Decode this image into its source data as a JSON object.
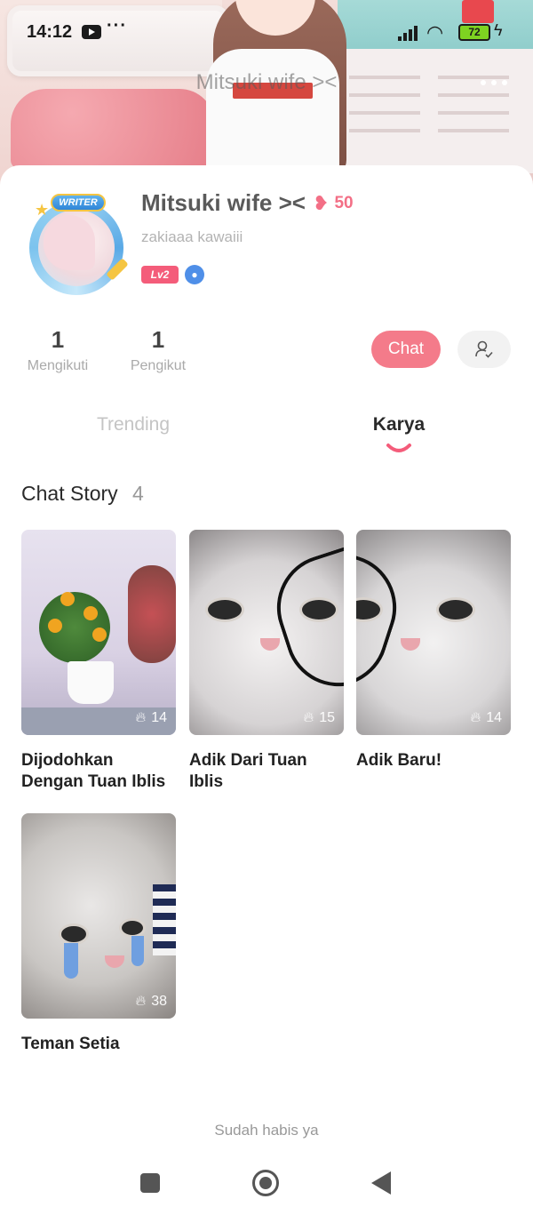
{
  "status_bar": {
    "time": "14:12",
    "dots": "···",
    "battery": "72"
  },
  "banner": {
    "title": "Mitsuki wife ><"
  },
  "profile": {
    "name": "Mitsuki wife ><",
    "heart_count": "50",
    "bio": "zakiaaa kawaiii",
    "level": "Lv2",
    "avatar_badge": "WRITER"
  },
  "stats": {
    "following": {
      "value": "1",
      "label": "Mengikuti"
    },
    "followers": {
      "value": "1",
      "label": "Pengikut"
    }
  },
  "actions": {
    "chat_label": "Chat"
  },
  "tabs": [
    {
      "label": "Trending",
      "active": false
    },
    {
      "label": "Karya",
      "active": true
    }
  ],
  "section": {
    "title": "Chat Story",
    "count": "4"
  },
  "stories": [
    {
      "title": "Dijodohkan Dengan Tuan Iblis",
      "views": "14",
      "image": "flowers"
    },
    {
      "title": "Adik Dari Tuan Iblis",
      "views": "15",
      "image": "cat-left"
    },
    {
      "title": "Adik Baru!",
      "views": "14",
      "image": "cat-right"
    },
    {
      "title": "Teman Setia",
      "views": "38",
      "image": "cat-crying"
    }
  ],
  "footer": {
    "end_text": "Sudah habis ya"
  },
  "colors": {
    "accent": "#f47b8a",
    "level_badge": "#f45c7a",
    "heart": "#f36f86"
  }
}
